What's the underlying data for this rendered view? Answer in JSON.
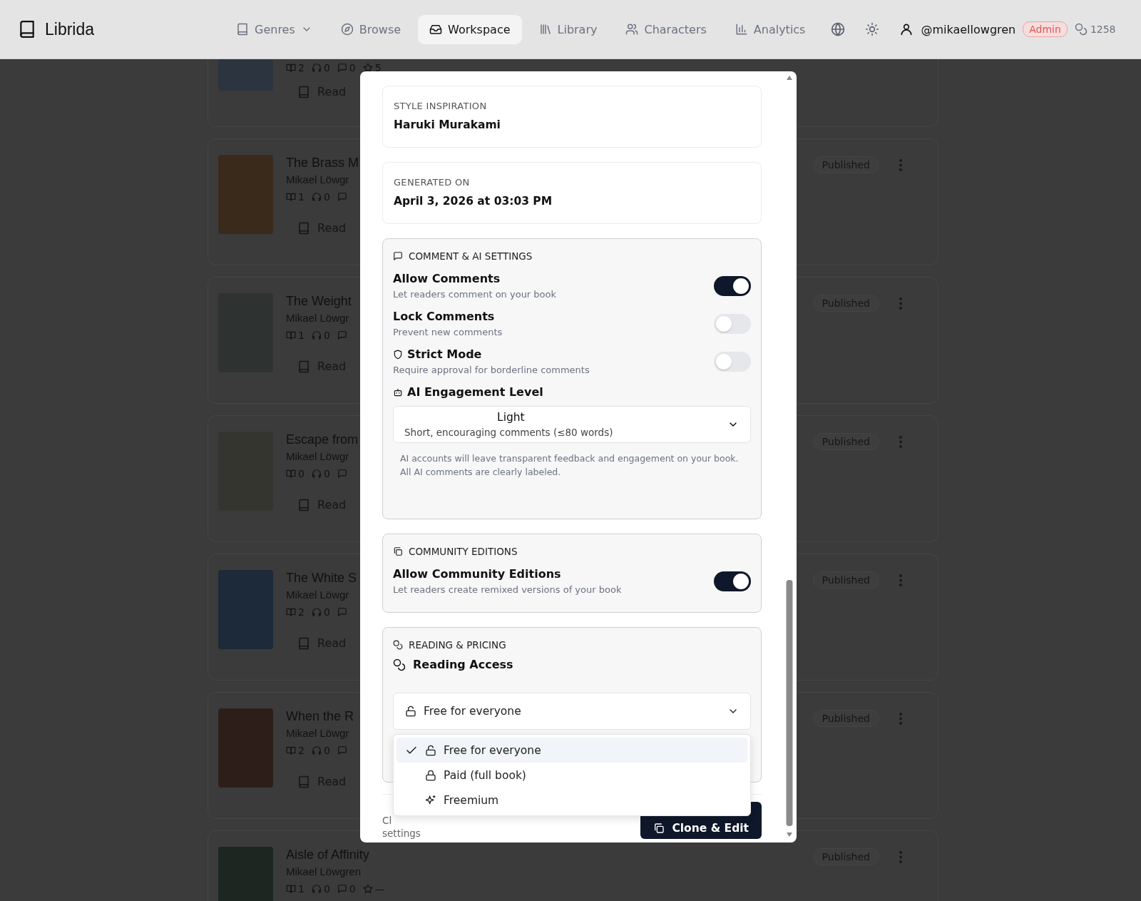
{
  "header": {
    "logo": "Librida",
    "nav": [
      {
        "label": "Genres",
        "kind": "dropdown",
        "selected": false
      },
      {
        "label": "Browse",
        "kind": "link",
        "selected": false
      },
      {
        "label": "Workspace",
        "kind": "link",
        "selected": true
      },
      {
        "label": "Library",
        "kind": "link",
        "selected": false
      },
      {
        "label": "Characters",
        "kind": "link",
        "selected": false
      },
      {
        "label": "Analytics",
        "kind": "link",
        "selected": false
      }
    ],
    "user": "@mikaellowgren",
    "role_badge": "Admin",
    "credits": "1258"
  },
  "books": [
    {
      "stats": [
        {
          "kind": "reads",
          "value": "2"
        },
        {
          "kind": "listens",
          "value": "0"
        },
        {
          "kind": "comments",
          "value": "0"
        },
        {
          "kind": "rating",
          "value": "5"
        }
      ],
      "read": "Read"
    },
    {
      "title": "The Brass M",
      "author": "Mikael Löwgr",
      "stats": [
        {
          "kind": "reads",
          "value": "1"
        },
        {
          "kind": "listens",
          "value": "0"
        },
        {
          "kind": "comments"
        }
      ],
      "read": "Read",
      "status": "Published"
    },
    {
      "title": "The Weight",
      "author": "Mikael Löwgr",
      "stats": [
        {
          "kind": "reads",
          "value": "1"
        },
        {
          "kind": "listens",
          "value": "0"
        },
        {
          "kind": "comments"
        }
      ],
      "read": "Read",
      "status": "Published"
    },
    {
      "title": "Escape from",
      "author": "Mikael Löwgr",
      "stats": [
        {
          "kind": "reads",
          "value": "0"
        },
        {
          "kind": "listens",
          "value": "0"
        },
        {
          "kind": "comments"
        }
      ],
      "read": "Read",
      "status": "Published"
    },
    {
      "title": "The White S",
      "author": "Mikael Löwgr",
      "stats": [
        {
          "kind": "reads",
          "value": "2"
        },
        {
          "kind": "listens",
          "value": "0"
        },
        {
          "kind": "comments"
        }
      ],
      "read": "Read",
      "status": "Published"
    },
    {
      "title": "When the R",
      "author": "Mikael Löwgr",
      "stats": [
        {
          "kind": "reads",
          "value": "2"
        },
        {
          "kind": "listens",
          "value": "0"
        },
        {
          "kind": "comments"
        }
      ],
      "read": "Read",
      "status": "Published"
    },
    {
      "title": "Aisle of Affinity",
      "author": "Mikael Löwgren",
      "stats": [
        {
          "kind": "reads",
          "value": "1"
        },
        {
          "kind": "listens",
          "value": "0"
        },
        {
          "kind": "comments",
          "value": "0"
        },
        {
          "kind": "rating",
          "value": "—"
        }
      ],
      "status": "Published"
    }
  ],
  "modal": {
    "info": [
      {
        "label": "STYLE INSPIRATION",
        "value": "Haruki Murakami"
      },
      {
        "label": "GENERATED ON",
        "value": "April 3, 2026 at 03:03 PM"
      }
    ],
    "comment_settings": {
      "heading": "COMMENT & AI SETTINGS",
      "toggles": [
        {
          "title": "Allow Comments",
          "description": "Let readers comment on your book",
          "on": true
        },
        {
          "title": "Lock Comments",
          "description": "Prevent new comments",
          "on": false
        },
        {
          "title": "Strict Mode",
          "description": "Require approval for borderline comments",
          "on": false
        }
      ],
      "engagement": {
        "label": "AI Engagement Level",
        "value": "Light",
        "description": "Short, encouraging comments (≤80 words)"
      },
      "note": [
        "AI accounts will leave transparent feedback and engagement on your book.",
        "All AI comments are clearly labeled."
      ]
    },
    "community": {
      "heading": "COMMUNITY EDITIONS",
      "toggle": {
        "title": "Allow Community Editions",
        "description": "Let readers create remixed versions of your book",
        "on": true
      }
    },
    "pricing": {
      "heading": "READING & PRICING",
      "label": "Reading Access",
      "value": "Free for everyone",
      "options": [
        {
          "label": "Free for everyone",
          "selected": true
        },
        {
          "label": "Paid (full book)",
          "selected": false
        },
        {
          "label": "Freemium",
          "selected": false
        }
      ]
    },
    "footer": {
      "note": [
        "Cl",
        "settings"
      ],
      "button": "Clone & Edit"
    }
  }
}
